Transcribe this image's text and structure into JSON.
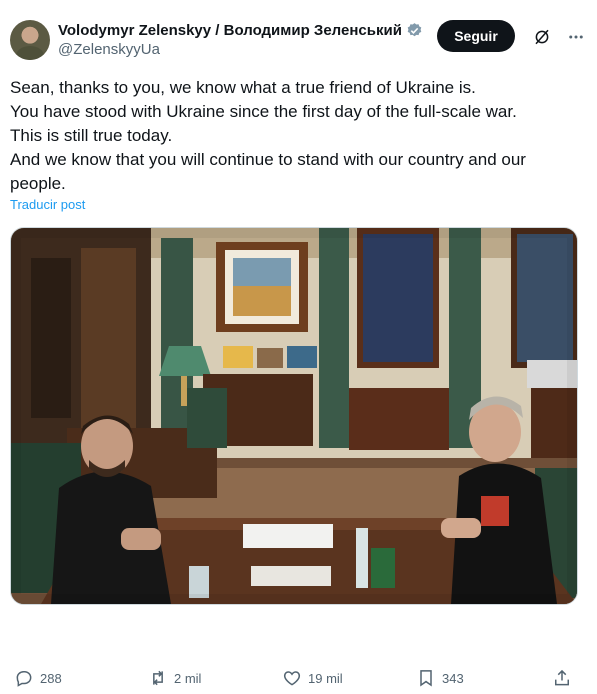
{
  "author": {
    "display_name": "Volodymyr Zelenskyy / Володимир Зеленський",
    "handle": "@ZelenskyyUa"
  },
  "header": {
    "follow_label": "Seguir",
    "grok_icon": "grok-slash-icon",
    "more_icon": "more-horizontal-icon"
  },
  "post": {
    "lines": [
      "Sean, thanks to you, we know what a true friend of Ukraine is.",
      "You have stood with Ukraine since the first day of the full-scale war.",
      "This is still true today.",
      "And we know that you will continue to stand with our country and our",
      "people."
    ],
    "translate_label": "Traducir post"
  },
  "actions": {
    "replies": "288",
    "reposts": "2 mil",
    "likes": "19 mil",
    "bookmarks": "343"
  },
  "colors": {
    "accent": "#1d9bf0",
    "verified": "#829aab",
    "follow_bg": "#0f1419",
    "muted": "#536471"
  }
}
